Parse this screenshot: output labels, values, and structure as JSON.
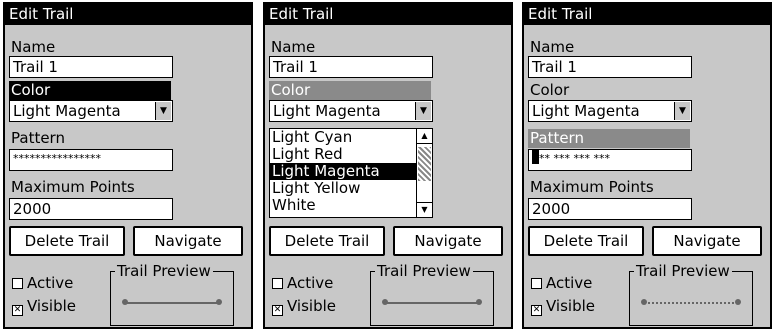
{
  "panels": [
    {
      "title": "Edit Trail",
      "name_label": "Name",
      "name_value": "Trail 1",
      "color_label": "Color",
      "color_value": "Light Magenta",
      "pattern_label": "Pattern",
      "pattern_value": "****************",
      "max_points_label": "Maximum Points",
      "max_points_value": "2000",
      "delete_button": "Delete Trail",
      "navigate_button": "Navigate",
      "active_label": "Active",
      "active_checked": false,
      "visible_label": "Visible",
      "visible_checked": true,
      "preview_label": "Trail Preview",
      "highlighted_field": "Color",
      "preview_style": "solid"
    },
    {
      "title": "Edit Trail",
      "name_label": "Name",
      "name_value": "Trail 1",
      "color_label": "Color",
      "color_value": "Light Magenta",
      "color_options": [
        "Light Cyan",
        "Light Red",
        "Light Magenta",
        "Light Yellow",
        "White"
      ],
      "selected_option": "Light Magenta",
      "delete_button": "Delete Trail",
      "navigate_button": "Navigate",
      "active_label": "Active",
      "active_checked": false,
      "visible_label": "Visible",
      "visible_checked": true,
      "preview_label": "Trail Preview",
      "highlighted_field": "Color",
      "preview_style": "solid"
    },
    {
      "title": "Edit Trail",
      "name_label": "Name",
      "name_value": "Trail 1",
      "color_label": "Color",
      "color_value": "Light Magenta",
      "pattern_label": "Pattern",
      "pattern_value": "** *** *** ***",
      "max_points_label": "Maximum Points",
      "max_points_value": "2000",
      "delete_button": "Delete Trail",
      "navigate_button": "Navigate",
      "active_label": "Active",
      "active_checked": false,
      "visible_label": "Visible",
      "visible_checked": true,
      "preview_label": "Trail Preview",
      "highlighted_field": "Pattern",
      "preview_style": "dotted"
    }
  ],
  "colors": {
    "panel_bg": "#c8c8c8",
    "highlight": "#000000",
    "highlight_dim": "#8a8a8a"
  }
}
